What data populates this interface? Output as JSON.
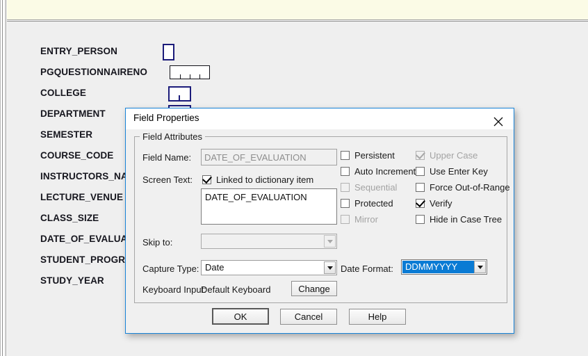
{
  "window": {
    "background_color": "#efefef",
    "top_band_color": "#fbfbe6"
  },
  "form_fields": [
    {
      "label": "ENTRY_PERSON",
      "widget": "checkbox-tall"
    },
    {
      "label": "PGQUESTIONNAIRENO",
      "widget": "segmented-box"
    },
    {
      "label": "COLLEGE",
      "widget": "box-with-tick"
    },
    {
      "label": "DEPARTMENT",
      "widget": "box"
    },
    {
      "label": "SEMESTER",
      "widget": "none"
    },
    {
      "label": "COURSE_CODE",
      "widget": "none"
    },
    {
      "label": "INSTRUCTORS_NAME",
      "widget": "none"
    },
    {
      "label": "LECTURE_VENUE",
      "widget": "none"
    },
    {
      "label": "CLASS_SIZE",
      "widget": "none"
    },
    {
      "label": "DATE_OF_EVALUATION",
      "widget": "none"
    },
    {
      "label": "STUDENT_PROGRAMME",
      "widget": "none"
    },
    {
      "label": "STUDY_YEAR",
      "widget": "none"
    }
  ],
  "dialog": {
    "title": "Field Properties",
    "close_icon": "close-icon",
    "group_legend": "Field Attributes",
    "field_name_label": "Field Name:",
    "field_name_value": "DATE_OF_EVALUATION",
    "screen_text_label": "Screen Text:",
    "linked_checkbox_label": "Linked to dictionary item",
    "screen_text_value": "DATE_OF_EVALUATION",
    "skip_to_label": "Skip to:",
    "skip_to_value": "",
    "capture_type_label": "Capture Type:",
    "capture_type_value": "Date",
    "date_format_label": "Date Format:",
    "date_format_value": "DDMMYYYY",
    "keyboard_input_label": "Keyboard Input:",
    "keyboard_input_value": "Default Keyboard",
    "change_button_label": "Change",
    "checkboxes_left": [
      {
        "label": "Persistent",
        "checked": false,
        "enabled": true
      },
      {
        "label": "Auto Increment",
        "checked": false,
        "enabled": true
      },
      {
        "label": "Sequential",
        "checked": false,
        "enabled": false
      },
      {
        "label": "Protected",
        "checked": false,
        "enabled": true
      },
      {
        "label": "Mirror",
        "checked": false,
        "enabled": false
      }
    ],
    "checkboxes_right": [
      {
        "label": "Upper Case",
        "checked": true,
        "enabled": false
      },
      {
        "label": "Use Enter Key",
        "checked": false,
        "enabled": true
      },
      {
        "label": "Force Out-of-Range",
        "checked": false,
        "enabled": true
      },
      {
        "label": "Verify",
        "checked": true,
        "enabled": true
      },
      {
        "label": "Hide in Case Tree",
        "checked": false,
        "enabled": true
      }
    ],
    "buttons": {
      "ok": "OK",
      "cancel": "Cancel",
      "help": "Help"
    },
    "accent_color": "#1883d7",
    "selection_color": "#0a7bd4"
  }
}
